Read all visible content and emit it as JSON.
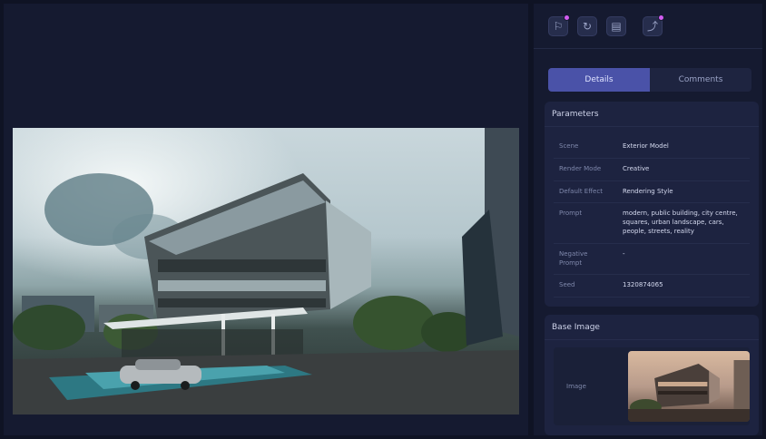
{
  "toolbar": {
    "tools": [
      {
        "icon": "flag-icon",
        "glyph": "⚐",
        "badge": true
      },
      {
        "icon": "refresh-icon",
        "glyph": "↻",
        "badge": false
      },
      {
        "icon": "save-icon",
        "glyph": "▤",
        "badge": false
      },
      {
        "icon": "upscale-icon",
        "glyph": "⤴",
        "badge": true
      }
    ],
    "badge_color": "#d25cf0"
  },
  "tabs": [
    {
      "label": "Details",
      "active": true
    },
    {
      "label": "Comments",
      "active": false
    }
  ],
  "parameters": {
    "title": "Parameters",
    "rows": [
      {
        "key": "Scene",
        "value": "Exterior Model"
      },
      {
        "key": "Render Mode",
        "value": "Creative"
      },
      {
        "key": "Default Effect",
        "value": "Rendering Style"
      },
      {
        "key": "Prompt",
        "value": "modern, public building, city centre, squares, urban landscape, cars, people, streets, reality"
      },
      {
        "key": "Negative Prompt",
        "value": "-"
      },
      {
        "key": "Seed",
        "value": "1320874065"
      }
    ]
  },
  "base_image": {
    "title": "Base Image",
    "label": "Image"
  },
  "colors": {
    "accent": "#4a52a8",
    "background": "#0f1324",
    "panel": "#1d2340"
  }
}
